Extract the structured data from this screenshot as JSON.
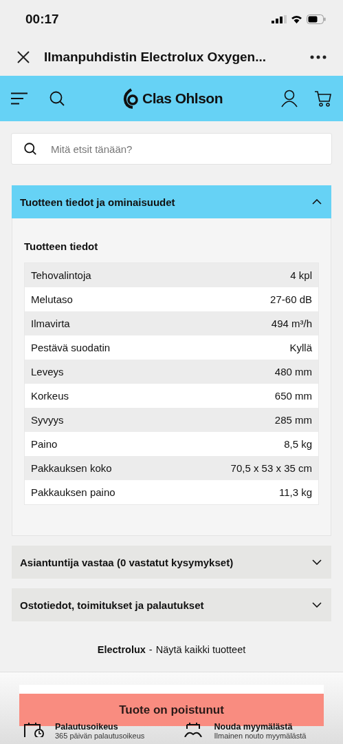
{
  "status_bar": {
    "time": "00:17"
  },
  "nav": {
    "title": "Ilmanpuhdistin Electrolux Oxygen..."
  },
  "header": {
    "logo": "Clas Ohlson"
  },
  "search": {
    "placeholder": "Mitä etsit tänään?"
  },
  "sections": [
    {
      "title": "Tuotteen tiedot ja ominaisuudet",
      "expanded": true,
      "subtitle": "Tuotteen tiedot",
      "rows": [
        {
          "label": "Tehovalintoja",
          "value": "4 kpl"
        },
        {
          "label": "Melutaso",
          "value": "27-60 dB"
        },
        {
          "label": "Ilmavirta",
          "value": "494 m³/h"
        },
        {
          "label": "Pestävä suodatin",
          "value": "Kyllä"
        },
        {
          "label": "Leveys",
          "value": "480 mm"
        },
        {
          "label": "Korkeus",
          "value": "650 mm"
        },
        {
          "label": "Syvyys",
          "value": "285 mm"
        },
        {
          "label": "Paino",
          "value": "8,5 kg"
        },
        {
          "label": "Pakkauksen koko",
          "value": "70,5 x 53 x 35 cm"
        },
        {
          "label": "Pakkauksen paino",
          "value": "11,3  kg"
        }
      ]
    },
    {
      "title": "Asiantuntija vastaa (0 vastatut kysymykset)",
      "expanded": false
    },
    {
      "title": "Ostotiedot, toimitukset ja palautukset",
      "expanded": false
    }
  ],
  "brand_line": {
    "brand": "Electrolux",
    "separator": "-",
    "link": "Näytä kaikki tuotteet"
  },
  "buy_button": {
    "label": "Tuote on poistunut",
    "disabled": true
  },
  "features": [
    {
      "kind": "return",
      "title": "Palautusoikeus",
      "text": "365 päivän palautusoikeus"
    },
    {
      "kind": "pickup",
      "title": "Nouda myymälästä",
      "text": "Ilmainen nouto myymälästä"
    }
  ]
}
